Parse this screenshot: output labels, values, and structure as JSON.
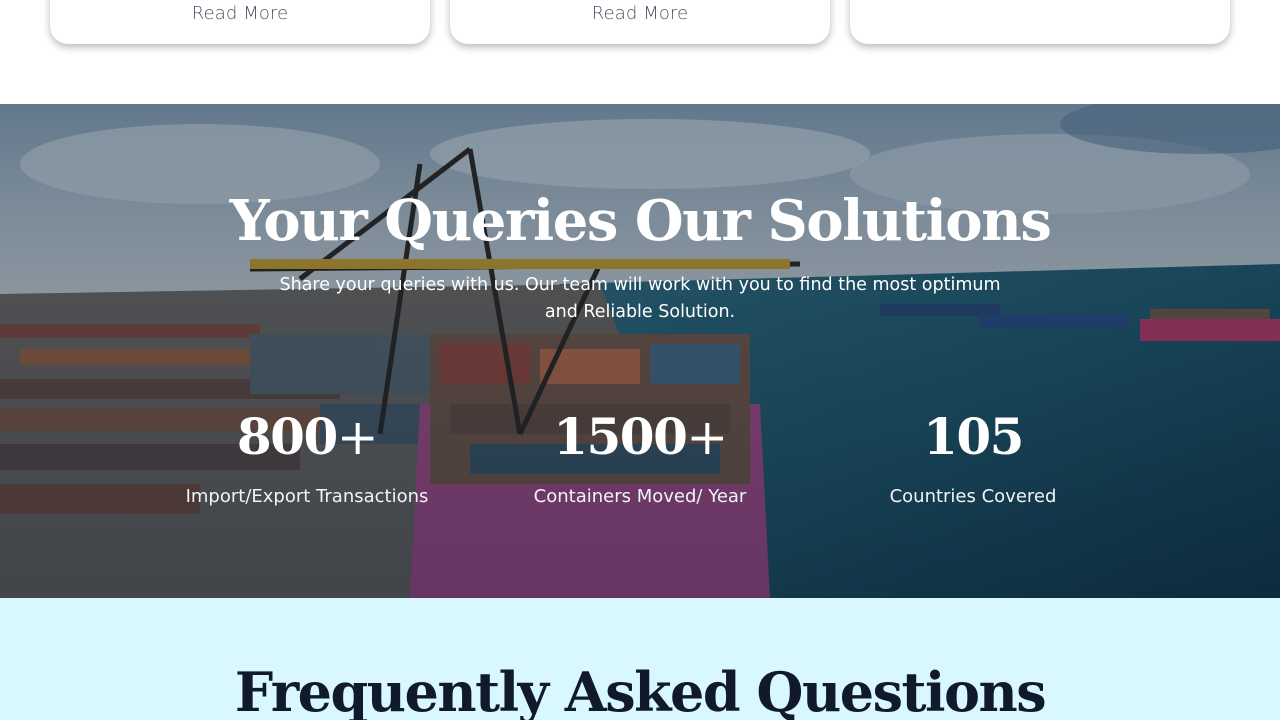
{
  "cards": [
    {
      "link_label": "Read More"
    },
    {
      "link_label": "Read More"
    },
    {
      "link_label": ""
    }
  ],
  "hero": {
    "title": "Your Queries Our Solutions",
    "subtitle": "Share your queries with us. Our team will work with you to find the most optimum and Reliable Solution.",
    "background": "container-port-photo",
    "stats": [
      {
        "value": "800",
        "suffix": "+",
        "label": "Import/Export Transactions"
      },
      {
        "value": "1500",
        "suffix": "+",
        "label": "Containers Moved/ Year"
      },
      {
        "value": "105",
        "suffix": "",
        "label": "Countries Covered"
      }
    ]
  },
  "faq": {
    "title": "Frequently Asked Questions",
    "background_color": "#d9f7ff"
  }
}
